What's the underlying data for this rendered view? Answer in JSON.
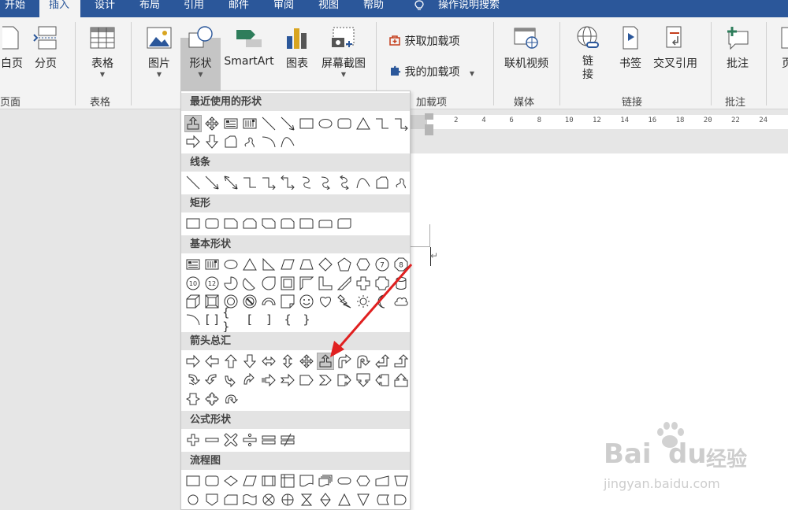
{
  "tabs": [
    {
      "label": "开始",
      "active": false
    },
    {
      "label": "插入",
      "active": true
    },
    {
      "label": "设计",
      "active": false
    },
    {
      "label": "布局",
      "active": false
    },
    {
      "label": "引用",
      "active": false
    },
    {
      "label": "邮件",
      "active": false
    },
    {
      "label": "审阅",
      "active": false
    },
    {
      "label": "视图",
      "active": false
    },
    {
      "label": "帮助",
      "active": false
    },
    {
      "label": "操作说明搜索",
      "active": false
    }
  ],
  "ribbon": {
    "buttons": {
      "blank_page": "白页",
      "page_break": "分页",
      "table": "表格",
      "picture": "图片",
      "shapes": "形状",
      "smartart": "SmartArt",
      "chart": "图表",
      "screenshot": "屏幕截图",
      "get_addins": "获取加载项",
      "my_addins": "我的加载项",
      "online_video": "联机视频",
      "link": "链接",
      "bookmark": "书签",
      "cross_ref": "交叉引用",
      "comment": "批注",
      "header_partial": "页"
    },
    "groups": {
      "pages": "页面",
      "tables": "表格",
      "addins": "加载项",
      "media": "媒体",
      "links": "链接",
      "comments": "批注"
    }
  },
  "ruler": {
    "ticks": [
      "2",
      "4",
      "6",
      "8",
      "10",
      "12",
      "14",
      "16",
      "18",
      "20",
      "22",
      "24"
    ]
  },
  "dropdown": {
    "sections": {
      "recent": "最近使用的形状",
      "lines": "线条",
      "rectangles": "矩形",
      "basic": "基本形状",
      "arrows": "箭头总汇",
      "equation": "公式形状",
      "flowchart": "流程图"
    },
    "basic_labels": {
      "oct7": "7",
      "oct8": "8",
      "dec10": "10",
      "dodec12": "12"
    }
  },
  "watermark": {
    "brand": "Bai",
    "brand2": "du",
    "brand3": "经验",
    "url": "jingyan.baidu.com"
  },
  "colors": {
    "accent": "#2b579a",
    "annotation": "#e02020",
    "ribbon_bg": "#f3f3f3"
  }
}
